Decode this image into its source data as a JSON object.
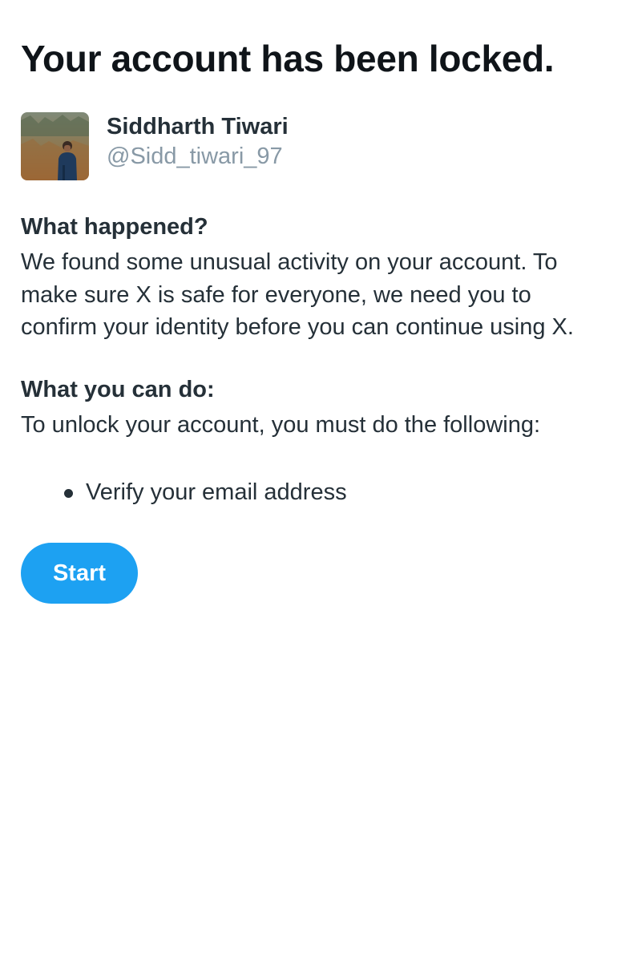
{
  "page": {
    "title": "Your account has been locked."
  },
  "profile": {
    "display_name": "Siddharth Tiwari",
    "handle": "@Sidd_tiwari_97",
    "avatar_icon": "user-photo"
  },
  "what_happened": {
    "heading": "What happened?",
    "lines": [
      "We found some unusual activity on your account. To",
      "make sure X is safe for everyone, we need you to",
      "confirm your identity before you can continue using X."
    ]
  },
  "what_you_can_do": {
    "heading": "What you can do:",
    "text": "To unlock your account, you must do the following:",
    "steps": [
      "Verify your email address"
    ]
  },
  "actions": {
    "start_label": "Start"
  },
  "colors": {
    "accent": "#1da1f2",
    "text_primary": "#253038",
    "text_secondary": "#8899a6",
    "background": "#ffffff"
  }
}
